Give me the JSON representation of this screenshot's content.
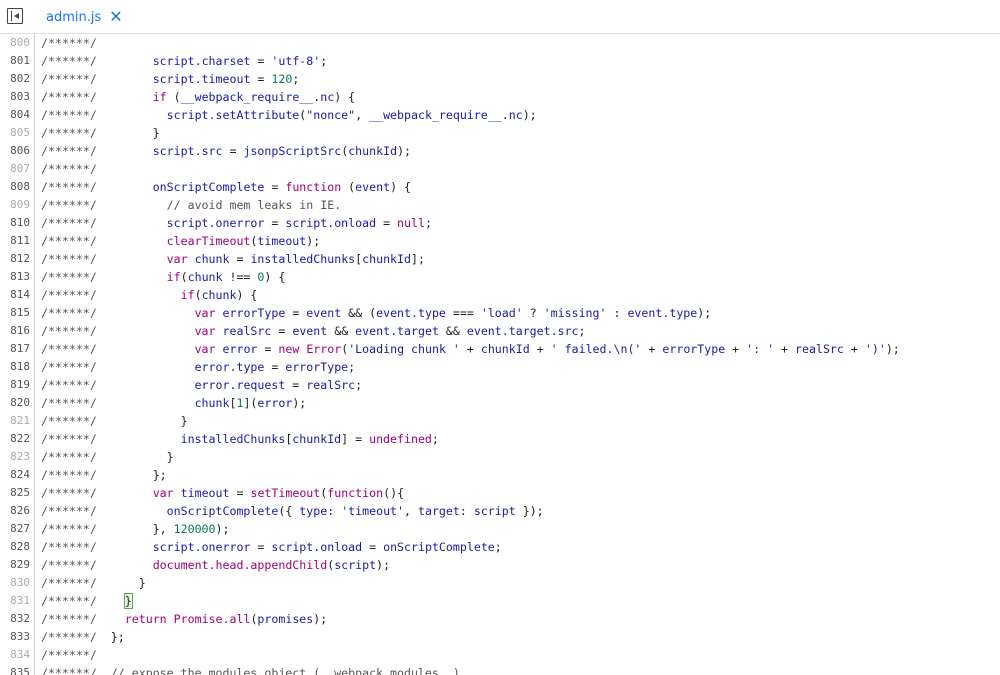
{
  "tab": {
    "filename": "admin.js",
    "close_glyph": "✕"
  },
  "icons": {
    "sidebar_toggle": "sidebar-toggle-icon",
    "close": "close-icon"
  },
  "lines": [
    {
      "n": "800",
      "code": [
        [
          "c",
          "/******/"
        ]
      ]
    },
    {
      "n": "801",
      "code": [
        [
          "c",
          "/******/ "
        ],
        [
          "p",
          "       "
        ],
        [
          "v",
          "script.charset"
        ],
        [
          "p",
          " = "
        ],
        [
          "s",
          "'utf-8'"
        ],
        [
          "p",
          ";"
        ]
      ]
    },
    {
      "n": "802",
      "code": [
        [
          "c",
          "/******/ "
        ],
        [
          "p",
          "       "
        ],
        [
          "v",
          "script.timeout"
        ],
        [
          "p",
          " = "
        ],
        [
          "n",
          "120"
        ],
        [
          "p",
          ";"
        ]
      ]
    },
    {
      "n": "803",
      "code": [
        [
          "c",
          "/******/ "
        ],
        [
          "p",
          "       "
        ],
        [
          "k",
          "if"
        ],
        [
          "p",
          " ("
        ],
        [
          "v",
          "__webpack_require__"
        ],
        [
          "p",
          "."
        ],
        [
          "v",
          "nc"
        ],
        [
          "p",
          ") {"
        ]
      ]
    },
    {
      "n": "804",
      "code": [
        [
          "c",
          "/******/ "
        ],
        [
          "p",
          "         "
        ],
        [
          "v",
          "script.setAttribute"
        ],
        [
          "p",
          "("
        ],
        [
          "s",
          "\"nonce\""
        ],
        [
          "p",
          ", "
        ],
        [
          "v",
          "__webpack_require__"
        ],
        [
          "p",
          "."
        ],
        [
          "v",
          "nc"
        ],
        [
          "p",
          ");"
        ]
      ]
    },
    {
      "n": "805",
      "code": [
        [
          "c",
          "/******/ "
        ],
        [
          "p",
          "       }"
        ]
      ]
    },
    {
      "n": "806",
      "code": [
        [
          "c",
          "/******/ "
        ],
        [
          "p",
          "       "
        ],
        [
          "v",
          "script.src"
        ],
        [
          "p",
          " = "
        ],
        [
          "v",
          "jsonpScriptSrc"
        ],
        [
          "p",
          "("
        ],
        [
          "v",
          "chunkId"
        ],
        [
          "p",
          ");"
        ]
      ]
    },
    {
      "n": "807",
      "code": [
        [
          "c",
          "/******/"
        ]
      ]
    },
    {
      "n": "808",
      "code": [
        [
          "c",
          "/******/ "
        ],
        [
          "p",
          "       "
        ],
        [
          "v",
          "onScriptComplete"
        ],
        [
          "p",
          " = "
        ],
        [
          "k",
          "function"
        ],
        [
          "p",
          " ("
        ],
        [
          "v",
          "event"
        ],
        [
          "p",
          ") {"
        ]
      ]
    },
    {
      "n": "809",
      "code": [
        [
          "c",
          "/******/ "
        ],
        [
          "p",
          "         "
        ],
        [
          "c",
          "// avoid mem leaks in IE."
        ]
      ]
    },
    {
      "n": "810",
      "code": [
        [
          "c",
          "/******/ "
        ],
        [
          "p",
          "         "
        ],
        [
          "v",
          "script.onerror"
        ],
        [
          "p",
          " = "
        ],
        [
          "v",
          "script.onload"
        ],
        [
          "p",
          " = "
        ],
        [
          "k",
          "null"
        ],
        [
          "p",
          ";"
        ]
      ]
    },
    {
      "n": "811",
      "code": [
        [
          "c",
          "/******/ "
        ],
        [
          "p",
          "         "
        ],
        [
          "k",
          "clearTimeout"
        ],
        [
          "p",
          "("
        ],
        [
          "v",
          "timeout"
        ],
        [
          "p",
          ");"
        ]
      ]
    },
    {
      "n": "812",
      "code": [
        [
          "c",
          "/******/ "
        ],
        [
          "p",
          "         "
        ],
        [
          "k",
          "var"
        ],
        [
          "p",
          " "
        ],
        [
          "v",
          "chunk"
        ],
        [
          "p",
          " = "
        ],
        [
          "v",
          "installedChunks"
        ],
        [
          "p",
          "["
        ],
        [
          "v",
          "chunkId"
        ],
        [
          "p",
          "];"
        ]
      ]
    },
    {
      "n": "813",
      "code": [
        [
          "c",
          "/******/ "
        ],
        [
          "p",
          "         "
        ],
        [
          "k",
          "if"
        ],
        [
          "p",
          "("
        ],
        [
          "v",
          "chunk"
        ],
        [
          "p",
          " !== "
        ],
        [
          "n",
          "0"
        ],
        [
          "p",
          ") {"
        ]
      ]
    },
    {
      "n": "814",
      "code": [
        [
          "c",
          "/******/ "
        ],
        [
          "p",
          "           "
        ],
        [
          "k",
          "if"
        ],
        [
          "p",
          "("
        ],
        [
          "v",
          "chunk"
        ],
        [
          "p",
          ") {"
        ]
      ]
    },
    {
      "n": "815",
      "code": [
        [
          "c",
          "/******/ "
        ],
        [
          "p",
          "             "
        ],
        [
          "k",
          "var"
        ],
        [
          "p",
          " "
        ],
        [
          "v",
          "errorType"
        ],
        [
          "p",
          " = "
        ],
        [
          "v",
          "event"
        ],
        [
          "p",
          " && ("
        ],
        [
          "v",
          "event.type"
        ],
        [
          "p",
          " === "
        ],
        [
          "s",
          "'load'"
        ],
        [
          "p",
          " ? "
        ],
        [
          "s",
          "'missing'"
        ],
        [
          "p",
          " : "
        ],
        [
          "v",
          "event.type"
        ],
        [
          "p",
          ");"
        ]
      ]
    },
    {
      "n": "816",
      "code": [
        [
          "c",
          "/******/ "
        ],
        [
          "p",
          "             "
        ],
        [
          "k",
          "var"
        ],
        [
          "p",
          " "
        ],
        [
          "v",
          "realSrc"
        ],
        [
          "p",
          " = "
        ],
        [
          "v",
          "event"
        ],
        [
          "p",
          " && "
        ],
        [
          "v",
          "event.target"
        ],
        [
          "p",
          " && "
        ],
        [
          "v",
          "event.target.src"
        ],
        [
          "p",
          ";"
        ]
      ]
    },
    {
      "n": "817",
      "code": [
        [
          "c",
          "/******/ "
        ],
        [
          "p",
          "             "
        ],
        [
          "k",
          "var"
        ],
        [
          "p",
          " "
        ],
        [
          "v",
          "error"
        ],
        [
          "p",
          " = "
        ],
        [
          "k",
          "new"
        ],
        [
          "p",
          " "
        ],
        [
          "k",
          "Error"
        ],
        [
          "p",
          "("
        ],
        [
          "s",
          "'Loading chunk '"
        ],
        [
          "p",
          " + "
        ],
        [
          "v",
          "chunkId"
        ],
        [
          "p",
          " + "
        ],
        [
          "s",
          "' failed.\\n('"
        ],
        [
          "p",
          " + "
        ],
        [
          "v",
          "errorType"
        ],
        [
          "p",
          " + "
        ],
        [
          "s",
          "': '"
        ],
        [
          "p",
          " + "
        ],
        [
          "v",
          "realSrc"
        ],
        [
          "p",
          " + "
        ],
        [
          "s",
          "')'"
        ],
        [
          "p",
          ");"
        ]
      ]
    },
    {
      "n": "818",
      "code": [
        [
          "c",
          "/******/ "
        ],
        [
          "p",
          "             "
        ],
        [
          "v",
          "error.type"
        ],
        [
          "p",
          " = "
        ],
        [
          "v",
          "errorType"
        ],
        [
          "p",
          ";"
        ]
      ]
    },
    {
      "n": "819",
      "code": [
        [
          "c",
          "/******/ "
        ],
        [
          "p",
          "             "
        ],
        [
          "v",
          "error.request"
        ],
        [
          "p",
          " = "
        ],
        [
          "v",
          "realSrc"
        ],
        [
          "p",
          ";"
        ]
      ]
    },
    {
      "n": "820",
      "code": [
        [
          "c",
          "/******/ "
        ],
        [
          "p",
          "             "
        ],
        [
          "v",
          "chunk"
        ],
        [
          "p",
          "["
        ],
        [
          "n",
          "1"
        ],
        [
          "p",
          "]("
        ],
        [
          "v",
          "error"
        ],
        [
          "p",
          ");"
        ]
      ]
    },
    {
      "n": "821",
      "code": [
        [
          "c",
          "/******/ "
        ],
        [
          "p",
          "           }"
        ]
      ]
    },
    {
      "n": "822",
      "code": [
        [
          "c",
          "/******/ "
        ],
        [
          "p",
          "           "
        ],
        [
          "v",
          "installedChunks"
        ],
        [
          "p",
          "["
        ],
        [
          "v",
          "chunkId"
        ],
        [
          "p",
          "] = "
        ],
        [
          "k",
          "undefined"
        ],
        [
          "p",
          ";"
        ]
      ]
    },
    {
      "n": "823",
      "code": [
        [
          "c",
          "/******/ "
        ],
        [
          "p",
          "         }"
        ]
      ]
    },
    {
      "n": "824",
      "code": [
        [
          "c",
          "/******/ "
        ],
        [
          "p",
          "       };"
        ]
      ]
    },
    {
      "n": "825",
      "code": [
        [
          "c",
          "/******/ "
        ],
        [
          "p",
          "       "
        ],
        [
          "k",
          "var"
        ],
        [
          "p",
          " "
        ],
        [
          "v",
          "timeout"
        ],
        [
          "p",
          " = "
        ],
        [
          "k",
          "setTimeout"
        ],
        [
          "p",
          "("
        ],
        [
          "k",
          "function"
        ],
        [
          "p",
          "(){"
        ]
      ]
    },
    {
      "n": "826",
      "code": [
        [
          "c",
          "/******/ "
        ],
        [
          "p",
          "         "
        ],
        [
          "v",
          "onScriptComplete"
        ],
        [
          "p",
          "({ "
        ],
        [
          "v",
          "type"
        ],
        [
          "p",
          ": "
        ],
        [
          "s",
          "'timeout'"
        ],
        [
          "p",
          ", "
        ],
        [
          "v",
          "target"
        ],
        [
          "p",
          ": "
        ],
        [
          "v",
          "script"
        ],
        [
          "p",
          " });"
        ]
      ]
    },
    {
      "n": "827",
      "code": [
        [
          "c",
          "/******/ "
        ],
        [
          "p",
          "       }, "
        ],
        [
          "n",
          "120000"
        ],
        [
          "p",
          ");"
        ]
      ]
    },
    {
      "n": "828",
      "code": [
        [
          "c",
          "/******/ "
        ],
        [
          "p",
          "       "
        ],
        [
          "v",
          "script.onerror"
        ],
        [
          "p",
          " = "
        ],
        [
          "v",
          "script.onload"
        ],
        [
          "p",
          " = "
        ],
        [
          "v",
          "onScriptComplete"
        ],
        [
          "p",
          ";"
        ]
      ]
    },
    {
      "n": "829",
      "code": [
        [
          "c",
          "/******/ "
        ],
        [
          "p",
          "       "
        ],
        [
          "k",
          "document.head.appendChild"
        ],
        [
          "p",
          "("
        ],
        [
          "v",
          "script"
        ],
        [
          "p",
          ");"
        ]
      ]
    },
    {
      "n": "830",
      "code": [
        [
          "c",
          "/******/ "
        ],
        [
          "p",
          "     }"
        ]
      ]
    },
    {
      "n": "831",
      "code": [
        [
          "c",
          "/******/ "
        ],
        [
          "p",
          "   "
        ],
        [
          "hl",
          "}"
        ]
      ]
    },
    {
      "n": "832",
      "code": [
        [
          "c",
          "/******/ "
        ],
        [
          "p",
          "   "
        ],
        [
          "k",
          "return"
        ],
        [
          "p",
          " "
        ],
        [
          "k",
          "Promise.all"
        ],
        [
          "p",
          "("
        ],
        [
          "v",
          "promises"
        ],
        [
          "p",
          ");"
        ]
      ]
    },
    {
      "n": "833",
      "code": [
        [
          "c",
          "/******/ "
        ],
        [
          "p",
          " };"
        ]
      ]
    },
    {
      "n": "834",
      "code": [
        [
          "c",
          "/******/"
        ]
      ]
    },
    {
      "n": "835",
      "code": [
        [
          "c",
          "/******/ "
        ],
        [
          "c",
          " // expose the modules object (__webpack_modules__)"
        ]
      ]
    }
  ]
}
